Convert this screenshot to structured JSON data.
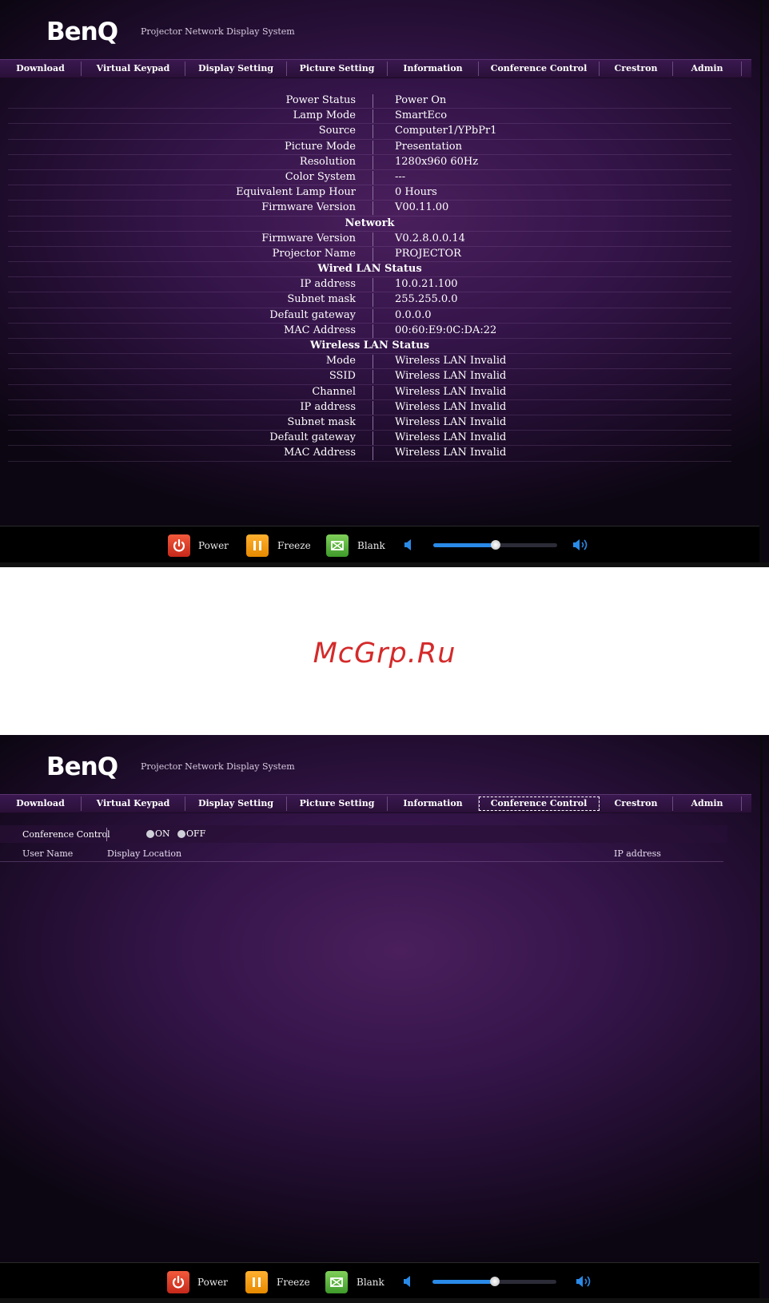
{
  "brand": {
    "logo": "BenQ",
    "tagline": "Projector Network Display System"
  },
  "nav": {
    "items": [
      "Download",
      "Virtual Keypad",
      "Display Setting",
      "Picture Setting",
      "Information",
      "Conference Control",
      "Crestron",
      "Admin"
    ]
  },
  "info": {
    "rows": [
      {
        "label": "Power Status",
        "value": "Power On"
      },
      {
        "label": "Lamp Mode",
        "value": "SmartEco"
      },
      {
        "label": "Source",
        "value": "Computer1/YPbPr1"
      },
      {
        "label": "Picture Mode",
        "value": "Presentation"
      },
      {
        "label": "Resolution",
        "value": "1280x960 60Hz"
      },
      {
        "label": "Color System",
        "value": "---"
      },
      {
        "label": "Equivalent Lamp Hour",
        "value": "0 Hours"
      },
      {
        "label": "Firmware Version",
        "value": "V00.11.00"
      },
      {
        "section": "Network"
      },
      {
        "label": "Firmware Version",
        "value": "V0.2.8.0.0.14"
      },
      {
        "label": "Projector Name",
        "value": "PROJECTOR"
      },
      {
        "section": "Wired LAN Status"
      },
      {
        "label": "IP address",
        "value": "10.0.21.100"
      },
      {
        "label": "Subnet mask",
        "value": "255.255.0.0"
      },
      {
        "label": "Default gateway",
        "value": "0.0.0.0"
      },
      {
        "label": "MAC Address",
        "value": "00:60:E9:0C:DA:22"
      },
      {
        "section": "Wireless LAN Status"
      },
      {
        "label": "Mode",
        "value": "Wireless LAN Invalid"
      },
      {
        "label": "SSID",
        "value": "Wireless LAN Invalid"
      },
      {
        "label": "Channel",
        "value": "Wireless LAN Invalid"
      },
      {
        "label": "IP address",
        "value": "Wireless LAN Invalid"
      },
      {
        "label": "Subnet mask",
        "value": "Wireless LAN Invalid"
      },
      {
        "label": "Default gateway",
        "value": "Wireless LAN Invalid"
      },
      {
        "label": "MAC Address",
        "value": "Wireless LAN Invalid"
      }
    ]
  },
  "controls": {
    "power_label": "Power",
    "freeze_label": "Freeze",
    "blank_label": "Blank",
    "volume_level": 0.5,
    "accent": "#2a8ae8"
  },
  "watermark": "McGrp.Ru",
  "conference": {
    "label": "Conference Control",
    "on_label": "ON",
    "off_label": "OFF",
    "columns": [
      "User Name",
      "Display Location",
      "IP address"
    ]
  }
}
